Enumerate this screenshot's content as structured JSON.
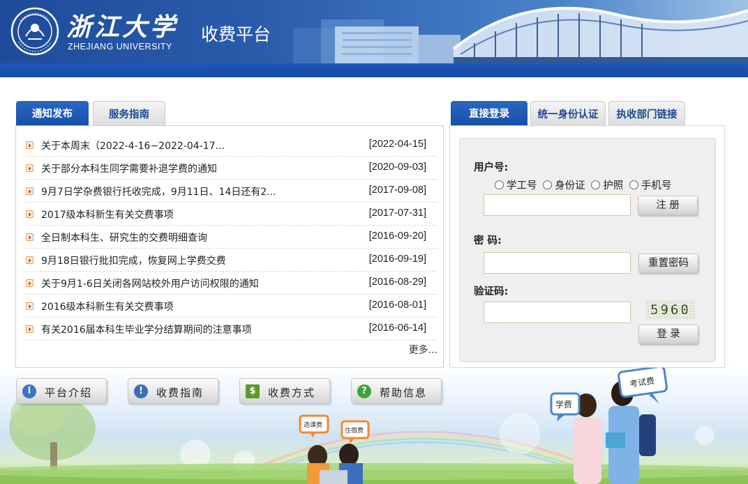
{
  "header": {
    "logo_cn": "浙江大学",
    "logo_en": "ZHEJIANG UNIVERSITY",
    "platform_title": "收费平台"
  },
  "news": {
    "tabs": [
      {
        "label": "通知发布",
        "active": true
      },
      {
        "label": "服务指南",
        "active": false
      }
    ],
    "items": [
      {
        "title": "关于本周末（2022-4-16~2022-04-17...",
        "date": "[2022-04-15]"
      },
      {
        "title": "关于部分本科生同学需要补退学费的通知",
        "date": "[2020-09-03]"
      },
      {
        "title": "9月7日学杂费银行托收完成，9月11日、14日还有2...",
        "date": "[2017-09-08]"
      },
      {
        "title": "2017级本科新生有关交费事项",
        "date": "[2017-07-31]"
      },
      {
        "title": "全日制本科生、研究生的交费明细查询",
        "date": "[2016-09-20]"
      },
      {
        "title": "9月18日银行批扣完成，恢复网上学费交费",
        "date": "[2016-09-19]"
      },
      {
        "title": "关于9月1-6日关闭各网站校外用户访问权限的通知",
        "date": "[2016-08-29]"
      },
      {
        "title": "2016级本科新生有关交费事项",
        "date": "[2016-08-01]"
      },
      {
        "title": "有关2016届本科生毕业学分结算期间的注意事项",
        "date": "[2016-06-14]"
      }
    ],
    "more": "更多..."
  },
  "bottom_buttons": [
    {
      "label": "平台介绍",
      "icon": "info-icon",
      "color": "#3a76c4"
    },
    {
      "label": "收费指南",
      "icon": "speech-icon",
      "color": "#3a6fb8"
    },
    {
      "label": "收费方式",
      "icon": "cash-icon",
      "color": "#5a9a2a"
    },
    {
      "label": "帮助信息",
      "icon": "help-icon",
      "color": "#3fa33a"
    }
  ],
  "login": {
    "tabs": [
      {
        "label": "直接登录",
        "active": true
      },
      {
        "label": "统一身份认证",
        "active": false
      },
      {
        "label": "执收部门链接",
        "active": false
      }
    ],
    "username_label": "用户号:",
    "id_types": [
      "学工号",
      "身份证",
      "护照",
      "手机号"
    ],
    "register_button": "注 册",
    "password_label": "密 码:",
    "reset_button": "重置密码",
    "captcha_label": "验证码:",
    "captcha_value": "5960",
    "login_button": "登 录"
  },
  "scene_bubbles": {
    "bubble_1": "学费",
    "bubble_2": "考试费",
    "bubble_3": "选课费",
    "bubble_4": "住宿费"
  },
  "colors": {
    "header_blue": "#1e4c9c",
    "tab_active": "#1750aa",
    "tab_text": "#1a4a94",
    "panel_border": "#dccfc0"
  }
}
